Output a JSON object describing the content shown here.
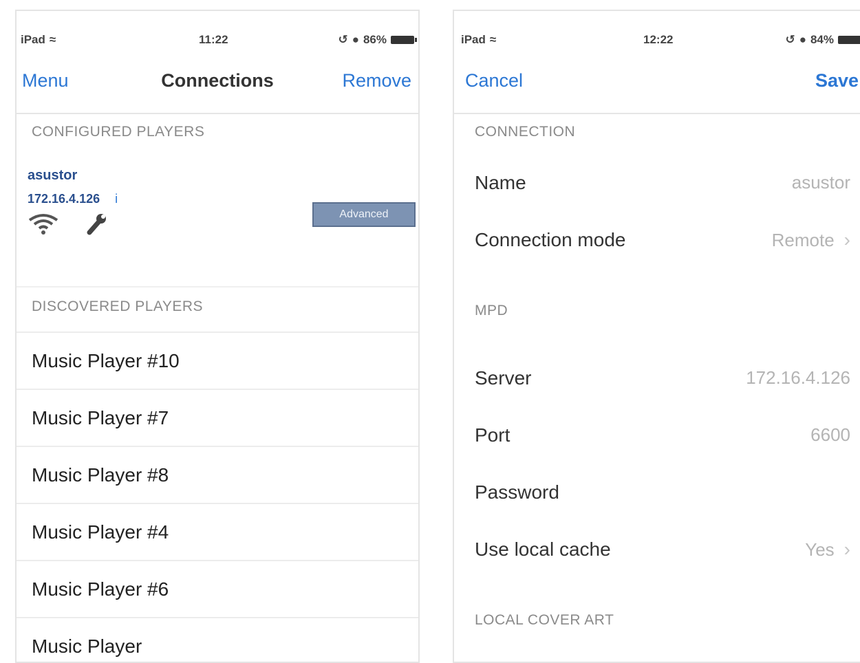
{
  "left": {
    "status": {
      "carrier": "iPad",
      "time": "11:22",
      "battery": "86%"
    },
    "nav": {
      "left": "Menu",
      "title": "Connections",
      "right": "Remove"
    },
    "configured_header": "CONFIGURED PLAYERS",
    "configured_player": {
      "name": "asustor",
      "ip": "172.16.4.126",
      "info": "i",
      "advanced": "Advanced"
    },
    "discovered_header": "DISCOVERED PLAYERS",
    "discovered": [
      "Music Player #10",
      "Music Player #7",
      "Music Player #8",
      "Music Player #4",
      "Music Player #6",
      "Music Player"
    ]
  },
  "right": {
    "status": {
      "carrier": "iPad",
      "time": "12:22",
      "battery": "84%"
    },
    "nav": {
      "left": "Cancel",
      "right": "Save"
    },
    "connection_header": "CONNECTION",
    "name": {
      "label": "Name",
      "value": "asustor"
    },
    "mode": {
      "label": "Connection mode",
      "value": "Remote"
    },
    "mpd_header": "MPD",
    "server": {
      "label": "Server",
      "value": "172.16.4.126"
    },
    "port": {
      "label": "Port",
      "value": "6600"
    },
    "password": {
      "label": "Password",
      "value": ""
    },
    "cache": {
      "label": "Use local cache",
      "value": "Yes"
    },
    "cover_header": "LOCAL COVER ART"
  },
  "colors": {
    "accent": "#2c77d4",
    "player_text": "#2a4f8e",
    "section": "#8a8a8a",
    "value": "#b4b4b4"
  }
}
